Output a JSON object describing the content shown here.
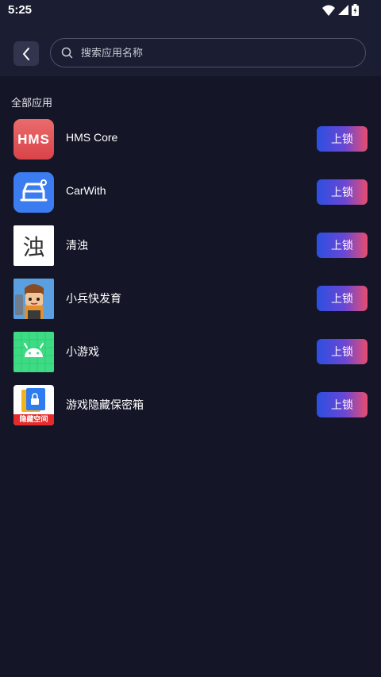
{
  "status_bar": {
    "time": "5:25"
  },
  "search": {
    "placeholder": "搜索应用名称"
  },
  "section_title": "全部应用",
  "colors": {
    "background": "#141628",
    "header": "#1b1e33",
    "button_gradient": [
      "#2c4fe0",
      "#e84d6f"
    ]
  },
  "apps": [
    {
      "name": "HMS Core",
      "icon": "hms-core-icon",
      "icon_text": "HMS",
      "button": "上锁"
    },
    {
      "name": "CarWith",
      "icon": "carwith-icon",
      "button": "上锁"
    },
    {
      "name": "清浊",
      "icon": "qingzhuo-icon",
      "icon_text": "浊",
      "button": "上锁"
    },
    {
      "name": "小兵快发育",
      "icon": "soldier-game-icon",
      "button": "上锁"
    },
    {
      "name": "小游戏",
      "icon": "android-icon",
      "button": "上锁"
    },
    {
      "name": "游戏隐藏保密箱",
      "icon": "hidden-space-icon",
      "icon_text": "隐藏空间",
      "button": "上锁"
    }
  ]
}
